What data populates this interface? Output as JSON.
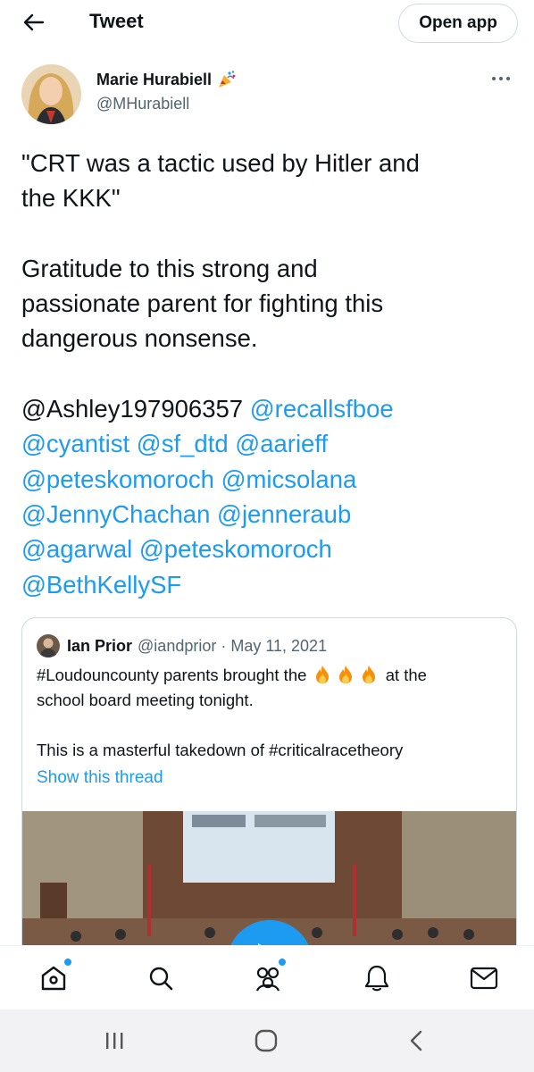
{
  "topbar": {
    "title": "Tweet",
    "open_app_label": "Open app",
    "back_icon": "back-arrow-icon"
  },
  "author": {
    "name": "Marie Hurabiell",
    "handle": "@MHurabiell",
    "badge_icon": "party-popper-icon",
    "more_icon": "more-dots-icon"
  },
  "tweet": {
    "quote_line_1": "\"CRT was a tactic used by Hitler and",
    "quote_line_2": "the KKK\"",
    "body_line_1": "Gratitude to this strong and",
    "body_line_2": "passionate parent for fighting this",
    "body_line_3": "dangerous nonsense.",
    "mentions": [
      "@Ashley197906357",
      "@recallsfboe",
      "@cyantist",
      "@sf_dtd",
      "@aarieff",
      "@peteskomoroch",
      "@micsolana",
      "@JennyChachan",
      "@jenneraub",
      "@agarwal",
      "@peteskomoroch",
      "@BethKellySF"
    ]
  },
  "quoted_tweet": {
    "name": "Ian Prior",
    "handle": "@iandprior",
    "separator": "·",
    "date": "May 11, 2021",
    "text_before_fire": "#Loudouncounty parents brought the",
    "text_after_fire": "at the",
    "text_line_2": "school board meeting tonight.",
    "text_line_3": "This is a masterful takedown of #criticalracetheory",
    "fire_icon": "fire-emoji-icon",
    "fire_count": 3,
    "show_thread_label": "Show this thread",
    "media_icon": "play-button-icon"
  },
  "bottom_nav": {
    "items": [
      {
        "icon": "home-icon",
        "has_dot": true
      },
      {
        "icon": "search-icon",
        "has_dot": false
      },
      {
        "icon": "communities-icon",
        "has_dot": true
      },
      {
        "icon": "bell-icon",
        "has_dot": false
      },
      {
        "icon": "mail-icon",
        "has_dot": false
      }
    ]
  },
  "system_nav": {
    "items": [
      {
        "icon": "recents-icon"
      },
      {
        "icon": "home-circle-icon"
      },
      {
        "icon": "back-chevron-icon"
      }
    ]
  },
  "colors": {
    "accent": "#1d9bf0",
    "text": "#0f1419",
    "muted": "#536471",
    "border": "#cfd9de"
  }
}
